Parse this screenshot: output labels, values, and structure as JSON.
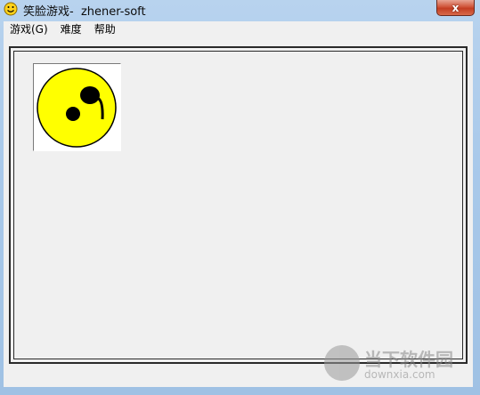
{
  "window": {
    "title": "笑脸游戏-  zhener-soft",
    "close_label": "x"
  },
  "menu": {
    "items": [
      {
        "label": "游戏(G)"
      },
      {
        "label": "难度"
      },
      {
        "label": "帮助"
      }
    ]
  },
  "board": {
    "face_color": "#ffff00",
    "face_icon": "smiley-face-icon"
  },
  "watermark": {
    "title": "当下软件园",
    "subtitle": "downxia.com"
  }
}
